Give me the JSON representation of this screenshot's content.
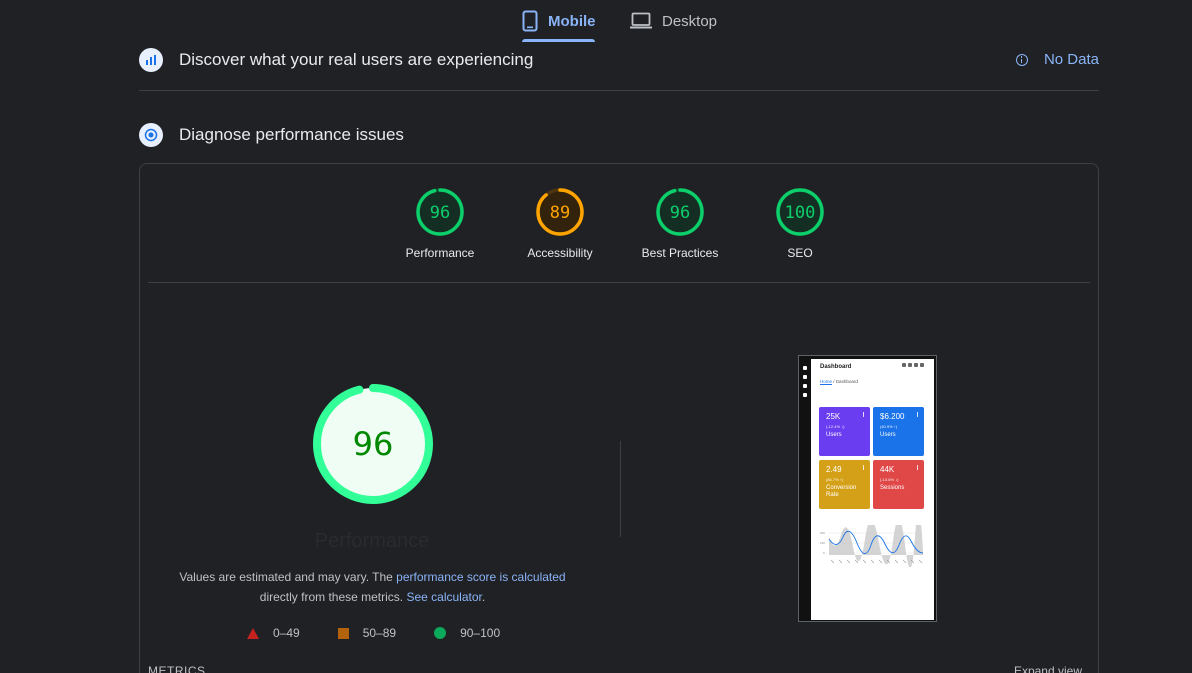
{
  "tabs": {
    "mobile": "Mobile",
    "desktop": "Desktop",
    "active": "Mobile"
  },
  "field_data": {
    "title": "Discover what your real users are experiencing",
    "status": "No Data"
  },
  "lab_data": {
    "title": "Diagnose performance issues"
  },
  "categories": [
    {
      "label": "Performance",
      "score": 96,
      "rating": "pass",
      "color": "#0cce6b"
    },
    {
      "label": "Accessibility",
      "score": 89,
      "rating": "average",
      "color": "#ffa400"
    },
    {
      "label": "Best Practices",
      "score": 96,
      "rating": "pass",
      "color": "#0cce6b"
    },
    {
      "label": "SEO",
      "score": 100,
      "rating": "pass",
      "color": "#0cce6b"
    }
  ],
  "performance": {
    "score": 96,
    "label": "Performance",
    "note_prefix": "Values are estimated and may vary. The ",
    "note_link1": "performance score is calculated",
    "note_middle": " directly from these metrics.",
    "note_link2": "See calculator",
    "note_suffix": "."
  },
  "legend": [
    {
      "shape": "triangle",
      "range": "0–49",
      "color": "#c5221f"
    },
    {
      "shape": "square",
      "range": "50–89",
      "color": "#b3630c"
    },
    {
      "shape": "circle",
      "range": "90–100",
      "color": "#0ca85b"
    }
  ],
  "metrics": {
    "label": "METRICS",
    "expand": "Expand view"
  },
  "screenshot": {
    "title": "Dashboard",
    "crumb_home": "Home",
    "crumb_sep": "/",
    "crumb_current": "Dashboard",
    "tiles": [
      {
        "value": "25K",
        "change": "(-12.4% ↓)",
        "name": "Users",
        "color": "#6a3df0"
      },
      {
        "value": "$6.200",
        "change": "(40.9% ↑)",
        "name": "Users",
        "color": "#1a73e8"
      },
      {
        "value": "2.49",
        "change": "(84.7% ↑)",
        "name": "Conversion Rate",
        "color": "#d4a017"
      },
      {
        "value": "44K",
        "change": "(-13.6% ↓)",
        "name": "Sessions",
        "color": "#e04848"
      }
    ]
  }
}
